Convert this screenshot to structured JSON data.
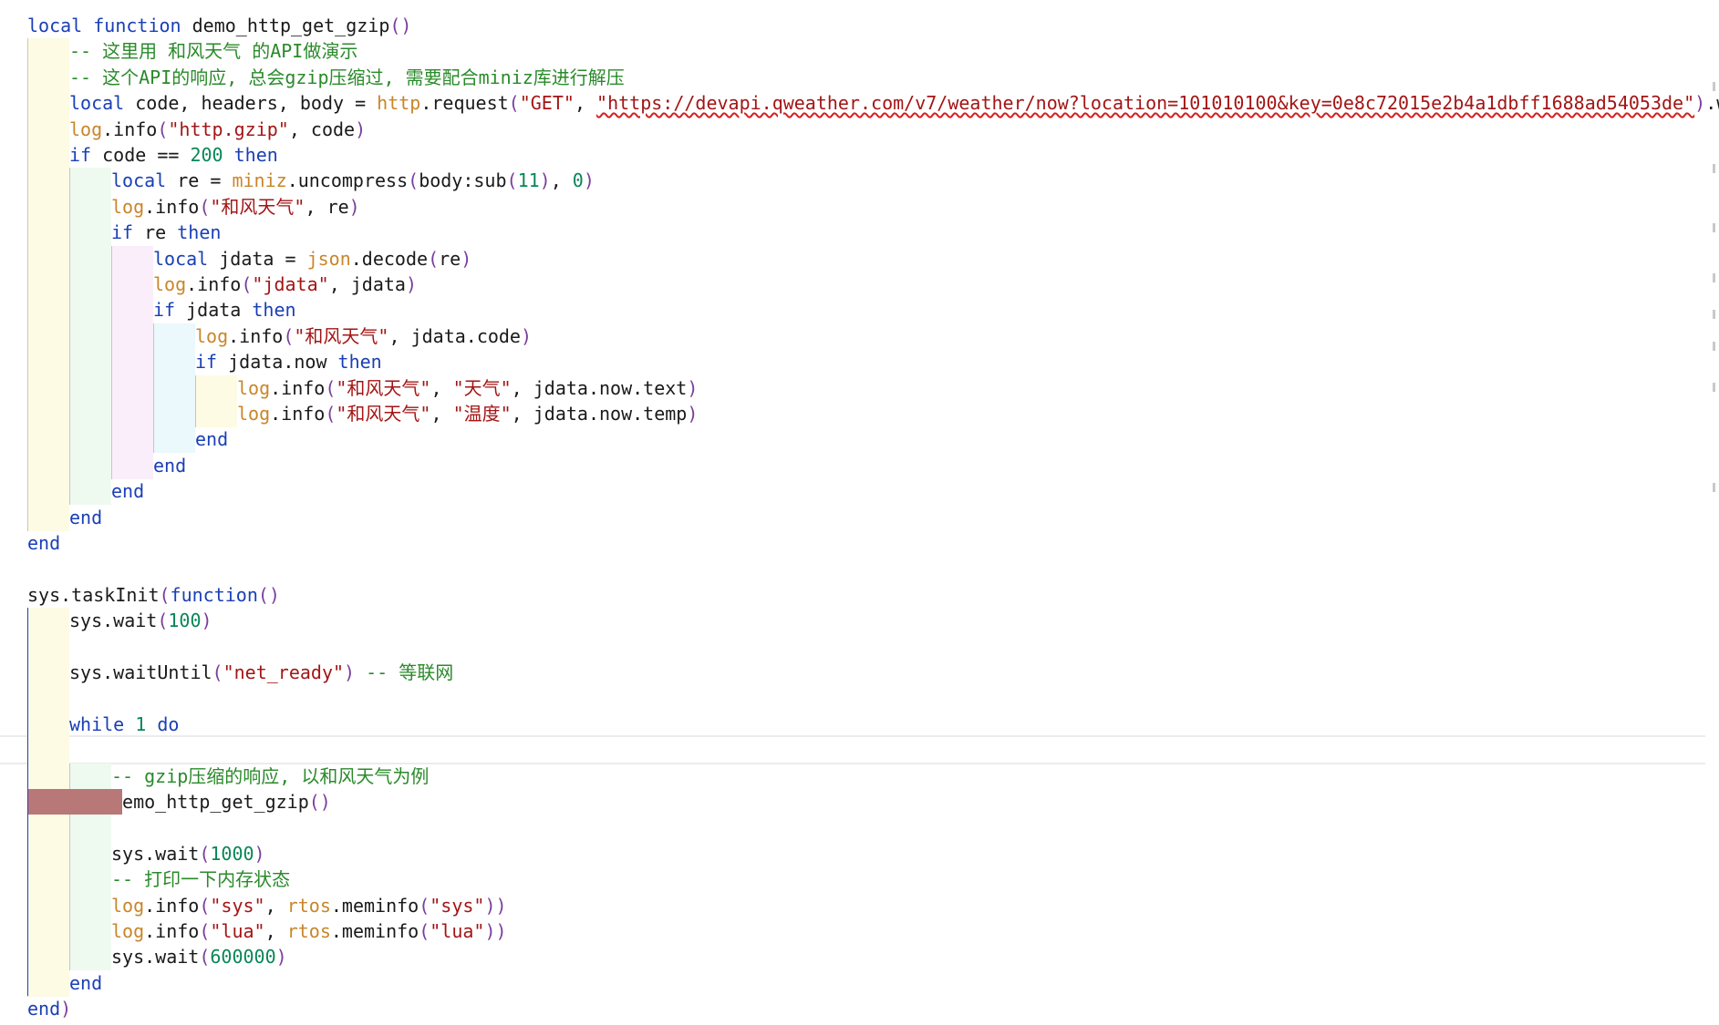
{
  "editor": {
    "code_lines": [
      [
        {
          "t": "local",
          "c": "kw"
        },
        {
          "t": " "
        },
        {
          "t": "function",
          "c": "kw"
        },
        {
          "t": " demo_http_get_gzip"
        },
        {
          "t": "()",
          "c": "br"
        }
      ],
      [
        {
          "t": "-- 这里用 和风天气 的API做演示",
          "c": "cm"
        }
      ],
      [
        {
          "t": "-- 这个API的响应, 总会gzip压缩过, 需要配合miniz库进行解压",
          "c": "cm"
        }
      ],
      [
        {
          "t": "local",
          "c": "kw"
        },
        {
          "t": " code, headers, body = "
        },
        {
          "t": "http",
          "c": "mod"
        },
        {
          "t": ".request"
        },
        {
          "t": "(",
          "c": "br"
        },
        {
          "t": "\"GET\"",
          "c": "str"
        },
        {
          "t": ", "
        },
        {
          "t": "\"https://devapi.qweather.com/v7/weather/now?location=101010100&key=0e8c72015e2b4a1dbff1688ad54053de\"",
          "c": "url"
        },
        {
          "t": ")",
          "c": "br"
        },
        {
          "t": ".wait"
        },
        {
          "t": "()",
          "c": "br"
        }
      ],
      [
        {
          "t": "log",
          "c": "mod"
        },
        {
          "t": ".info"
        },
        {
          "t": "(",
          "c": "br"
        },
        {
          "t": "\"http.gzip\"",
          "c": "str"
        },
        {
          "t": ", code"
        },
        {
          "t": ")",
          "c": "br"
        }
      ],
      [
        {
          "t": "if",
          "c": "kw"
        },
        {
          "t": " code == "
        },
        {
          "t": "200",
          "c": "num"
        },
        {
          "t": " "
        },
        {
          "t": "then",
          "c": "kw"
        }
      ],
      [
        {
          "t": "local",
          "c": "kw"
        },
        {
          "t": " re = "
        },
        {
          "t": "miniz",
          "c": "mod"
        },
        {
          "t": ".uncompress"
        },
        {
          "t": "(",
          "c": "br"
        },
        {
          "t": "body:sub"
        },
        {
          "t": "(",
          "c": "br"
        },
        {
          "t": "11",
          "c": "num"
        },
        {
          "t": ")",
          "c": "br"
        },
        {
          "t": ", "
        },
        {
          "t": "0",
          "c": "num"
        },
        {
          "t": ")",
          "c": "br"
        }
      ],
      [
        {
          "t": "log",
          "c": "mod"
        },
        {
          "t": ".info"
        },
        {
          "t": "(",
          "c": "br"
        },
        {
          "t": "\"和风天气\"",
          "c": "str"
        },
        {
          "t": ", re"
        },
        {
          "t": ")",
          "c": "br"
        }
      ],
      [
        {
          "t": "if",
          "c": "kw"
        },
        {
          "t": " re "
        },
        {
          "t": "then",
          "c": "kw"
        }
      ],
      [
        {
          "t": "local",
          "c": "kw"
        },
        {
          "t": " jdata = "
        },
        {
          "t": "json",
          "c": "mod"
        },
        {
          "t": ".decode"
        },
        {
          "t": "(",
          "c": "br"
        },
        {
          "t": "re"
        },
        {
          "t": ")",
          "c": "br"
        }
      ],
      [
        {
          "t": "log",
          "c": "mod"
        },
        {
          "t": ".info"
        },
        {
          "t": "(",
          "c": "br"
        },
        {
          "t": "\"jdata\"",
          "c": "str"
        },
        {
          "t": ", jdata"
        },
        {
          "t": ")",
          "c": "br"
        }
      ],
      [
        {
          "t": "if",
          "c": "kw"
        },
        {
          "t": " jdata "
        },
        {
          "t": "then",
          "c": "kw"
        }
      ],
      [
        {
          "t": "log",
          "c": "mod"
        },
        {
          "t": ".info"
        },
        {
          "t": "(",
          "c": "br"
        },
        {
          "t": "\"和风天气\"",
          "c": "str"
        },
        {
          "t": ", jdata.code"
        },
        {
          "t": ")",
          "c": "br"
        }
      ],
      [
        {
          "t": "if",
          "c": "kw"
        },
        {
          "t": " jdata.now "
        },
        {
          "t": "then",
          "c": "kw"
        }
      ],
      [
        {
          "t": "log",
          "c": "mod"
        },
        {
          "t": ".info"
        },
        {
          "t": "(",
          "c": "br"
        },
        {
          "t": "\"和风天气\"",
          "c": "str"
        },
        {
          "t": ", "
        },
        {
          "t": "\"天气\"",
          "c": "str"
        },
        {
          "t": ", jdata.now.text"
        },
        {
          "t": ")",
          "c": "br"
        }
      ],
      [
        {
          "t": "log",
          "c": "mod"
        },
        {
          "t": ".info"
        },
        {
          "t": "(",
          "c": "br"
        },
        {
          "t": "\"和风天气\"",
          "c": "str"
        },
        {
          "t": ", "
        },
        {
          "t": "\"温度\"",
          "c": "str"
        },
        {
          "t": ", jdata.now.temp"
        },
        {
          "t": ")",
          "c": "br"
        }
      ],
      [
        {
          "t": "end",
          "c": "kw"
        }
      ],
      [
        {
          "t": "end",
          "c": "kw"
        }
      ],
      [
        {
          "t": "end",
          "c": "kw"
        }
      ],
      [
        {
          "t": "end",
          "c": "kw"
        }
      ],
      [
        {
          "t": "end",
          "c": "kw"
        }
      ],
      [],
      [
        {
          "t": "sys.taskInit"
        },
        {
          "t": "(",
          "c": "br"
        },
        {
          "t": "function",
          "c": "kw"
        },
        {
          "t": "()",
          "c": "br"
        }
      ],
      [
        {
          "t": "sys.wait"
        },
        {
          "t": "(",
          "c": "br"
        },
        {
          "t": "100",
          "c": "num"
        },
        {
          "t": ")",
          "c": "br"
        }
      ],
      [],
      [
        {
          "t": "sys.waitUntil"
        },
        {
          "t": "(",
          "c": "br"
        },
        {
          "t": "\"net_ready\"",
          "c": "str"
        },
        {
          "t": ")",
          "c": "br"
        },
        {
          "t": " "
        },
        {
          "t": "-- 等联网",
          "c": "cm"
        }
      ],
      [],
      [
        {
          "t": "while",
          "c": "kw"
        },
        {
          "t": " "
        },
        {
          "t": "1",
          "c": "num"
        },
        {
          "t": " "
        },
        {
          "t": "do",
          "c": "kw"
        }
      ],
      [],
      [
        {
          "t": "-- gzip压缩的响应, 以和风天气为例",
          "c": "cm"
        }
      ],
      [
        {
          "t": "demo_http_get_gzip"
        },
        {
          "t": "()",
          "c": "br"
        }
      ],
      [],
      [
        {
          "t": "sys.wait"
        },
        {
          "t": "(",
          "c": "br"
        },
        {
          "t": "1000",
          "c": "num"
        },
        {
          "t": ")",
          "c": "br"
        }
      ],
      [
        {
          "t": "-- 打印一下内存状态",
          "c": "cm"
        }
      ],
      [
        {
          "t": "log",
          "c": "mod"
        },
        {
          "t": ".info"
        },
        {
          "t": "(",
          "c": "br"
        },
        {
          "t": "\"sys\"",
          "c": "str"
        },
        {
          "t": ", "
        },
        {
          "t": "rtos",
          "c": "mod"
        },
        {
          "t": ".meminfo"
        },
        {
          "t": "(",
          "c": "br"
        },
        {
          "t": "\"sys\"",
          "c": "str"
        },
        {
          "t": "))",
          "c": "br"
        }
      ],
      [
        {
          "t": "log",
          "c": "mod"
        },
        {
          "t": ".info"
        },
        {
          "t": "(",
          "c": "br"
        },
        {
          "t": "\"lua\"",
          "c": "str"
        },
        {
          "t": ", "
        },
        {
          "t": "rtos",
          "c": "mod"
        },
        {
          "t": ".meminfo"
        },
        {
          "t": "(",
          "c": "br"
        },
        {
          "t": "\"lua\"",
          "c": "str"
        },
        {
          "t": "))",
          "c": "br"
        }
      ],
      [
        {
          "t": "sys.wait"
        },
        {
          "t": "(",
          "c": "br"
        },
        {
          "t": "600000",
          "c": "num"
        },
        {
          "t": ")",
          "c": "br"
        }
      ],
      [
        {
          "t": "end",
          "c": "kw"
        }
      ],
      [
        {
          "t": "end",
          "c": "kw"
        },
        {
          "t": ")",
          "c": "br"
        }
      ]
    ],
    "indent_levels": [
      0,
      1,
      1,
      1,
      1,
      1,
      2,
      2,
      2,
      3,
      3,
      3,
      4,
      4,
      5,
      5,
      4,
      3,
      2,
      1,
      0,
      0,
      0,
      1,
      1,
      1,
      1,
      1,
      1,
      2,
      2,
      2,
      2,
      2,
      2,
      2,
      2,
      1,
      0
    ],
    "cursor_line_index": 28,
    "breakpoint_line_index": 30
  },
  "colors": {
    "keyword": "#1a3fb5",
    "string": "#a31515",
    "comment": "#2a8a2a",
    "number": "#098658",
    "module": "#c8862a",
    "bracket": "#7a3e9d",
    "identifier": "#1a1a1a",
    "indent_band_1": "#fdfbe4",
    "indent_band_2": "#eefaef",
    "indent_band_3": "#fbeefb",
    "indent_band_4": "#ebf8fc",
    "indent_band_5": "#fdfbe4"
  }
}
